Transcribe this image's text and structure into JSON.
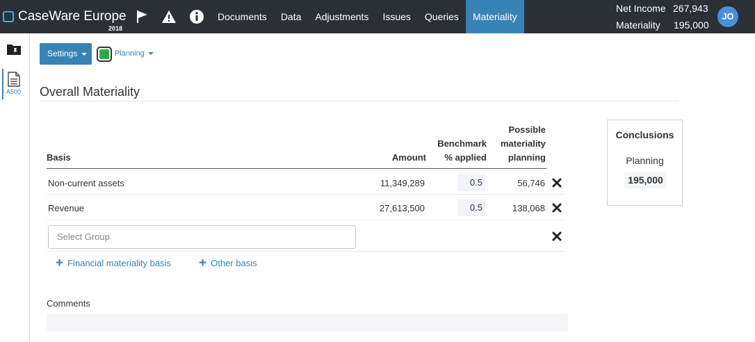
{
  "app": {
    "name": "CaseWare Europe",
    "year": "2018"
  },
  "nav": {
    "items": [
      {
        "label": "Documents"
      },
      {
        "label": "Data"
      },
      {
        "label": "Adjustments"
      },
      {
        "label": "Issues"
      },
      {
        "label": "Queries"
      },
      {
        "label": "Materiality"
      }
    ],
    "active": "Materiality"
  },
  "metrics": {
    "net_income_label": "Net Income",
    "net_income_value": "267,943",
    "materiality_label": "Materiality",
    "materiality_value": "195,000"
  },
  "user": {
    "initials": "JO"
  },
  "sidebar": {
    "doc_label": "A500"
  },
  "toolbar": {
    "settings_label": "Settings",
    "stage_label": "Planning",
    "status_color": "#2bab48"
  },
  "page": {
    "title": "Overall Materiality"
  },
  "table": {
    "headers": {
      "basis": "Basis",
      "amount": "Amount",
      "benchmark_line1": "Benchmark",
      "benchmark_line2": "% applied",
      "possible_line1": "Possible",
      "possible_line2": "materiality",
      "possible_line3": "planning"
    },
    "rows": [
      {
        "basis": "Non-current assets",
        "amount": "11,349,289",
        "percent": "0.5",
        "planning": "56,746"
      },
      {
        "basis": "Revenue",
        "amount": "27,613,500",
        "percent": "0.5",
        "planning": "138,068"
      }
    ],
    "select_placeholder": "Select Group",
    "add_financial_label": "Financial materiality basis",
    "add_other_label": "Other basis"
  },
  "comments": {
    "label": "Comments"
  },
  "conclusions": {
    "title": "Conclusions",
    "planning_label": "Planning",
    "planning_value": "195,000"
  },
  "colors": {
    "topbar": "#2b2f36",
    "accent": "#3783b6",
    "status_green": "#2bab48",
    "avatar": "#4a90d9"
  }
}
